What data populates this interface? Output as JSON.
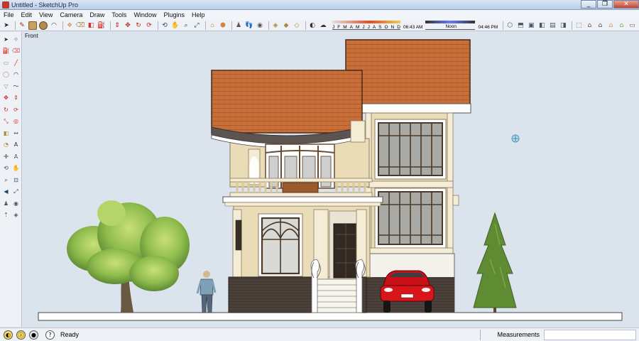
{
  "window": {
    "title": "Untitled - SketchUp Pro",
    "buttons": [
      "_",
      "❐",
      "✕"
    ]
  },
  "menu": [
    "File",
    "Edit",
    "View",
    "Camera",
    "Draw",
    "Tools",
    "Window",
    "Plugins",
    "Help"
  ],
  "shadows": {
    "months": [
      "J",
      "F",
      "M",
      "A",
      "M",
      "J",
      "J",
      "A",
      "S",
      "O",
      "N",
      "D"
    ],
    "time_start": "06:43 AM",
    "time_mid": "Noon",
    "time_end": "04:46 PM"
  },
  "viewport": {
    "view_label": "Front",
    "colors": {
      "sky": "#dbe4ec",
      "roof": "#c9703a",
      "wall": "#e9dcb7",
      "base": "#4b403a",
      "car": "#d8151b"
    }
  },
  "status": {
    "text": "Ready",
    "measurements_label": "Measurements",
    "measurements_value": ""
  }
}
